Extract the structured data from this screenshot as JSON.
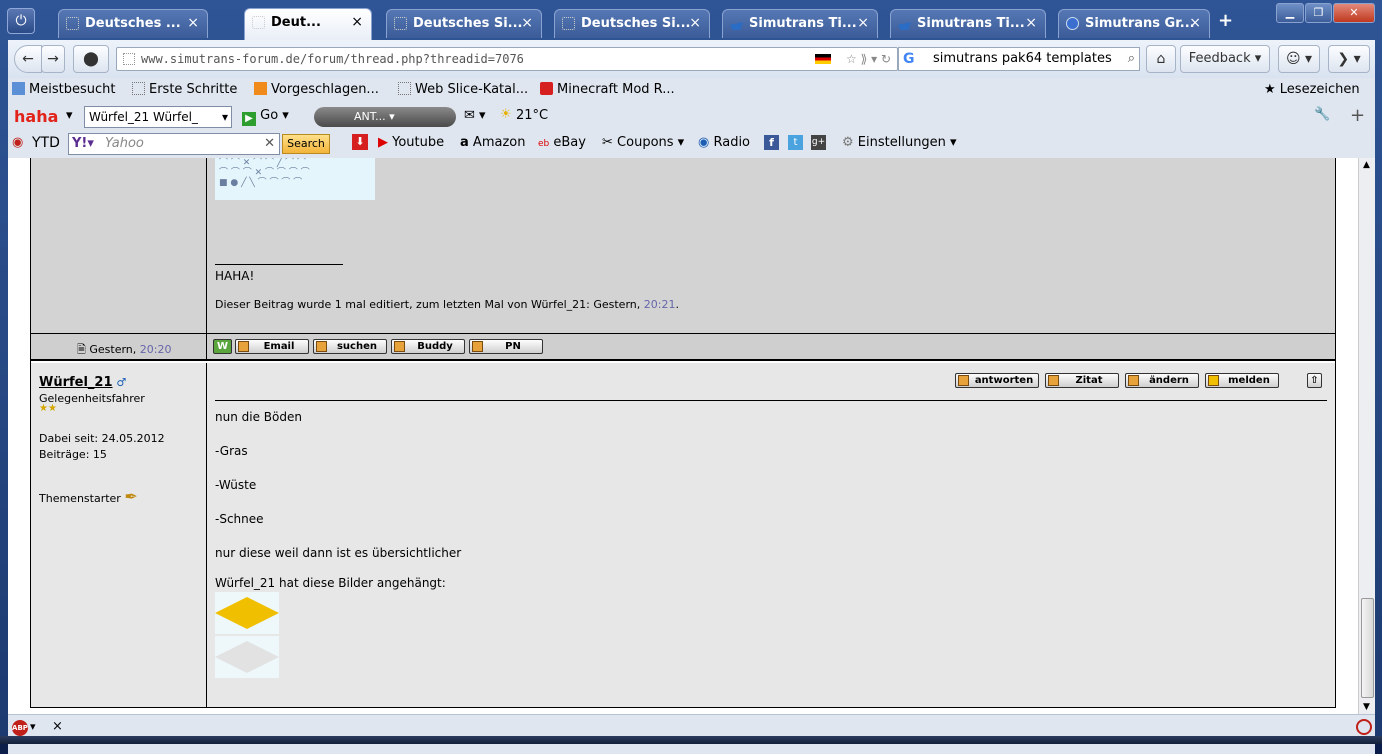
{
  "tabs": [
    {
      "label": "Deutsches ...",
      "icon": "page-icon",
      "active": false
    },
    {
      "label": "Deut...",
      "icon": "page-icon",
      "active": true
    },
    {
      "label": "Deutsches Si...",
      "icon": "page-icon",
      "active": false
    },
    {
      "label": "Deutsches Si...",
      "icon": "page-icon",
      "active": false
    },
    {
      "label": "Simutrans Ti...",
      "icon": "ship-icon",
      "active": false
    },
    {
      "label": "Simutrans Ti...",
      "icon": "ship-icon",
      "active": false
    },
    {
      "label": "Simutrans Gr...",
      "icon": "globe-icon",
      "active": false
    }
  ],
  "nav": {
    "url": "www.simutrans-forum.de/forum/thread.php?threadid=7076",
    "search_value": "simutrans pak64 templates",
    "feedback_label": "Feedback"
  },
  "bookmarks": [
    {
      "label": "Meistbesucht"
    },
    {
      "label": "Erste Schritte"
    },
    {
      "label": "Vorgeschlagen..."
    },
    {
      "label": "Web Slice-Katal..."
    },
    {
      "label": "Minecraft Mod R..."
    }
  ],
  "bookmarks_right": "Lesezeichen",
  "haha_bar": {
    "logo": "haha",
    "dropdown_value": "Würfel_21 Würfel_",
    "go_label": "Go",
    "radio_label": "ANT...",
    "weather": "21°C"
  },
  "ytd_bar": {
    "ytd_label": "YTD",
    "yahoo_placeholder": "Yahoo",
    "search_label": "Search",
    "links": [
      "Youtube",
      "Amazon",
      "eBay",
      "Coupons",
      "Radio"
    ],
    "settings_label": "Einstellungen"
  },
  "post1": {
    "signature": "HAHA!",
    "edit_note": "Dieser Beitrag wurde 1 mal editiert, zum letzten Mal von Würfel_21: Gestern,",
    "edit_time": "20:21",
    "footer_date": "Gestern,",
    "footer_time": "20:20",
    "buttons": [
      "Email",
      "suchen",
      "Buddy",
      "PN"
    ]
  },
  "post2": {
    "username": "Würfel_21",
    "rank": "Gelegenheitsfahrer",
    "joined": "Dabei seit: 24.05.2012",
    "posts": "Beiträge: 15",
    "starter": "Themenstarter",
    "actions": [
      "antworten",
      "Zitat",
      "ändern",
      "melden"
    ],
    "lines": [
      "nun die Böden",
      "-Gras",
      "-Wüste",
      "-Schnee",
      "nur diese weil dann ist es übersichtlicher"
    ],
    "attach_note": "Würfel_21 hat diese Bilder angehängt:",
    "attachment_colors": [
      "#f0c000",
      "#e2e2e2"
    ]
  },
  "colors": {
    "accent": "#2f5596",
    "post_bg": "#e7e7e7",
    "time_link": "#6666aa"
  }
}
